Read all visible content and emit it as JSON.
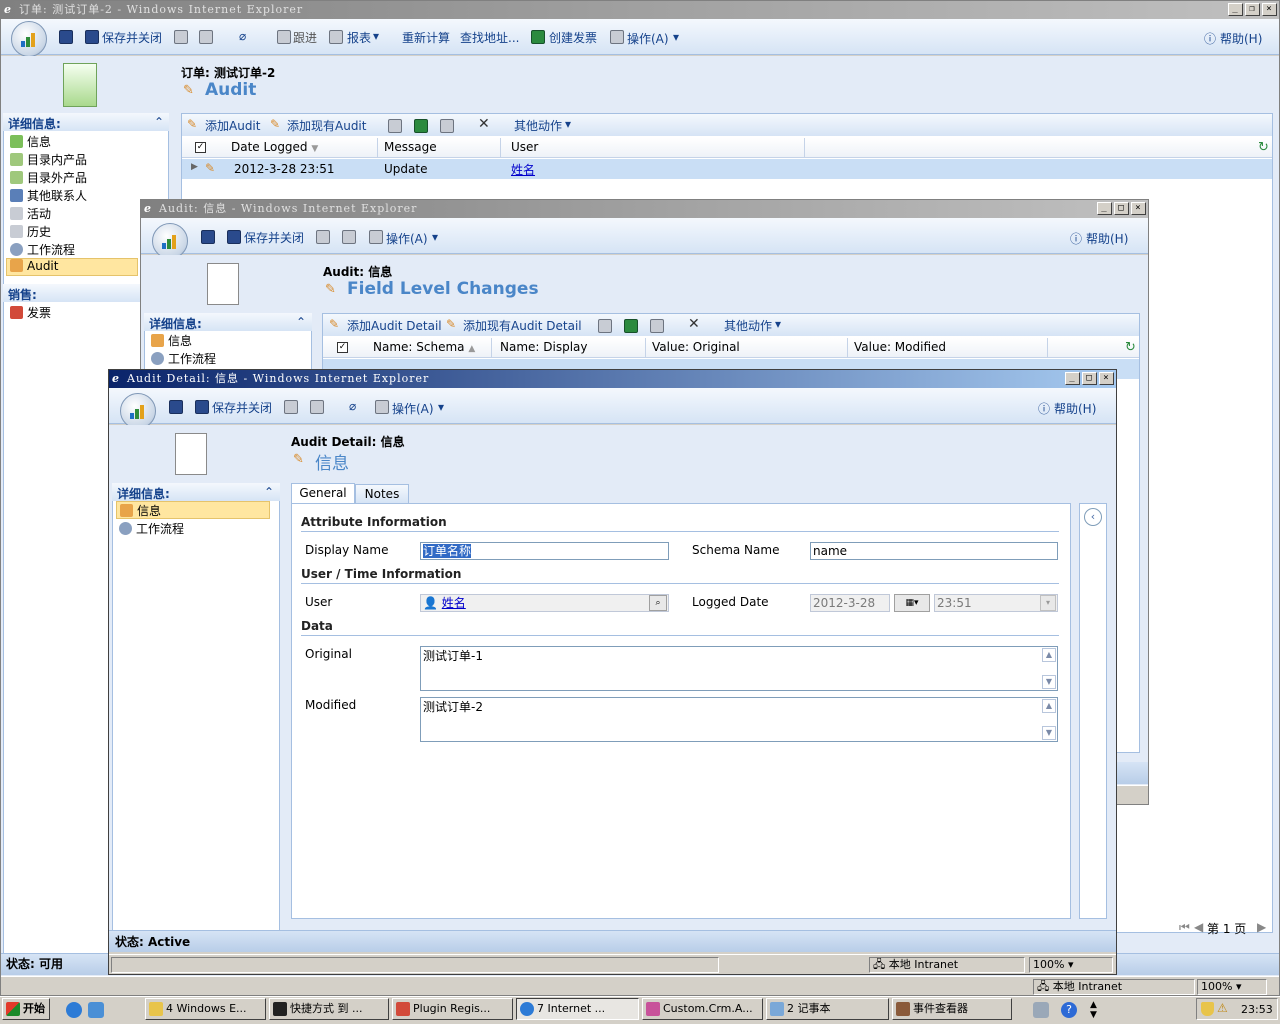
{
  "back_window": {
    "title": "订单: 测试订单-2 - Windows Internet Explorer",
    "toolbar": {
      "save_close": "保存并关闭",
      "follow_up": "跟进",
      "reports": "报表",
      "recalc": "重新计算",
      "find_address": "查找地址...",
      "create_invoice": "创建发票",
      "actions": "操作(A)",
      "help": "帮助(H)"
    },
    "entity": "订单: 测试订单-2",
    "view_title": "Audit",
    "nav": {
      "section_details": "详细信息:",
      "items": [
        "信息",
        "目录内产品",
        "目录外产品",
        "其他联系人",
        "活动",
        "历史",
        "工作流程",
        "Audit"
      ],
      "section_sales": "销售:",
      "sales_items": [
        "发票"
      ]
    },
    "grid_toolbar": {
      "add": "添加Audit",
      "add_existing": "添加现有Audit",
      "more": "其他动作"
    },
    "grid_columns": [
      "Date Logged",
      "Message",
      "User"
    ],
    "grid_row": {
      "date": "2012-3-28 23:51",
      "message": "Update",
      "user": "姓名"
    },
    "status": "状态: 可用",
    "zone": "本地 Intranet",
    "zoom": "100%",
    "paging": "第 1 页"
  },
  "middle_window": {
    "title": "Audit: 信息 - Windows Internet Explorer",
    "toolbar": {
      "save_close": "保存并关闭",
      "actions": "操作(A)",
      "help": "帮助(H)"
    },
    "entity": "Audit: 信息",
    "view_title": "Field Level Changes",
    "nav": {
      "section_details": "详细信息:",
      "items": [
        "信息",
        "工作流程"
      ]
    },
    "grid_toolbar": {
      "add": "添加Audit Detail",
      "add_existing": "添加现有Audit Detail",
      "more": "其他动作"
    },
    "grid_columns": [
      "Name: Schema",
      "Name: Display",
      "Value: Original",
      "Value: Modified"
    ]
  },
  "front_window": {
    "title": "Audit Detail: 信息 - Windows Internet Explorer",
    "toolbar": {
      "save_close": "保存并关闭",
      "actions": "操作(A)",
      "help": "帮助(H)"
    },
    "entity": "Audit Detail: 信息",
    "view_title": "信息",
    "nav": {
      "section_details": "详细信息:",
      "items": [
        "信息",
        "工作流程"
      ]
    },
    "tabs": [
      "General",
      "Notes"
    ],
    "sections": {
      "attribute": "Attribute Information",
      "user_time": "User / Time Information",
      "data": "Data"
    },
    "fields": {
      "display_name_label": "Display Name",
      "display_name": "订单名称",
      "schema_name_label": "Schema Name",
      "schema_name": "name",
      "user_label": "User",
      "user": "姓名",
      "logged_date_label": "Logged Date",
      "logged_date": "2012-3-28",
      "logged_time": "23:51",
      "original_label": "Original",
      "original": "测试订单-1",
      "modified_label": "Modified",
      "modified": "测试订单-2"
    },
    "status": "状态: Active",
    "zone": "本地 Intranet",
    "zoom": "100%"
  },
  "taskbar": {
    "start": "开始",
    "items": [
      "4 Windows E...",
      "快捷方式 到 ...",
      "Plugin Regis...",
      "7 Internet ...",
      "Custom.Crm.A...",
      "2 记事本",
      "事件查看器"
    ],
    "clock": "23:53"
  }
}
